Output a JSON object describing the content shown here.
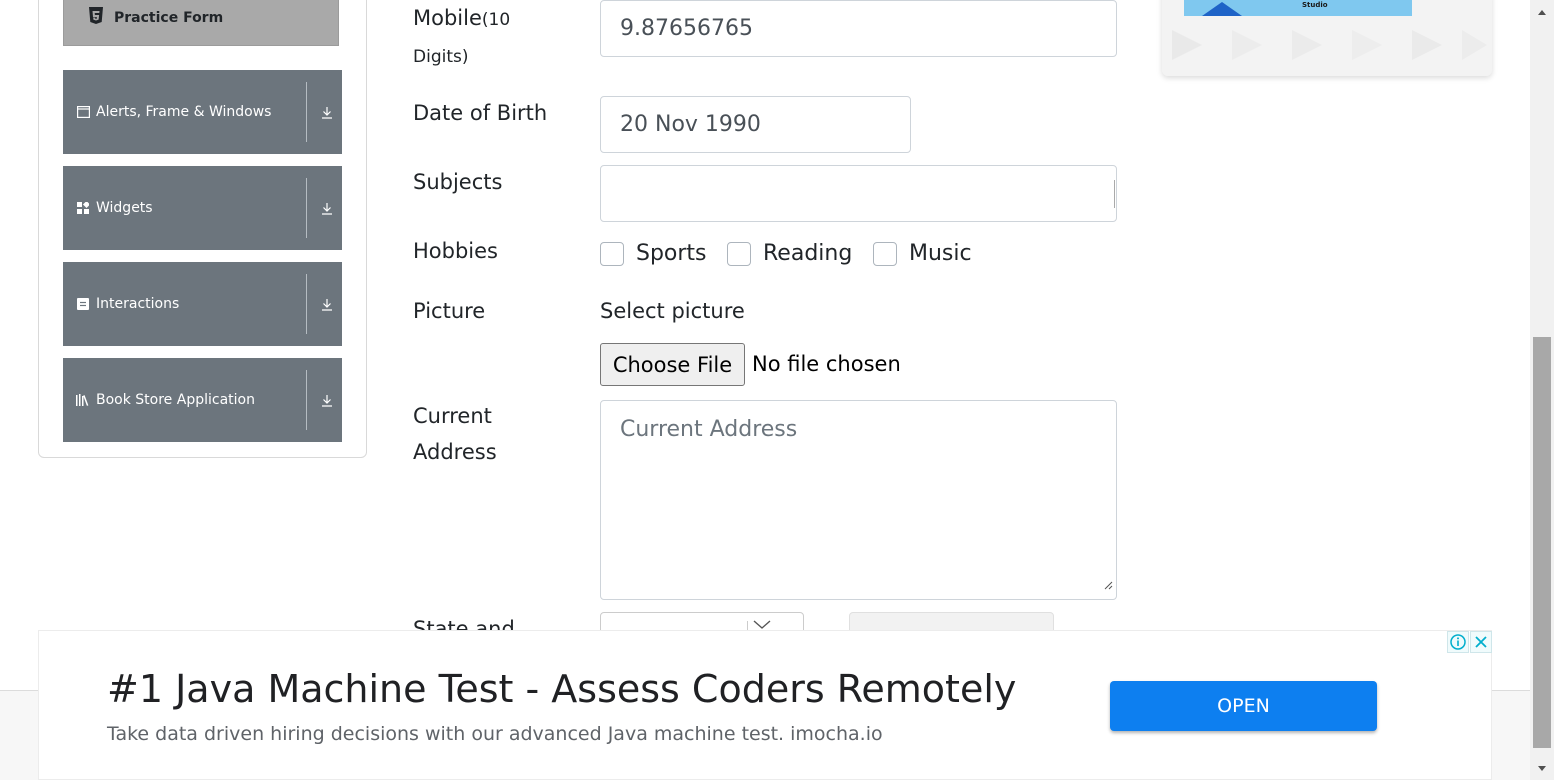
{
  "sidebar": {
    "practice_form": "Practice Form",
    "groups": [
      {
        "label": "Alerts, Frame & Windows",
        "icon": "window-icon"
      },
      {
        "label": "Widgets",
        "icon": "widgets-icon"
      },
      {
        "label": "Interactions",
        "icon": "interactions-icon"
      },
      {
        "label": "Book Store Application",
        "icon": "bookstore-icon"
      }
    ]
  },
  "form": {
    "mobile_label": "Mobile",
    "mobile_hint": "(10",
    "mobile_hint2": "Digits)",
    "mobile_value": "9.87656765",
    "dob_label": "Date of Birth",
    "dob_value": "20 Nov 1990",
    "subjects_label": "Subjects",
    "subjects_value": "",
    "hobbies_label": "Hobbies",
    "hobbies": [
      "Sports",
      "Reading",
      "Music"
    ],
    "picture_label": "Picture",
    "select_picture": "Select picture",
    "choose_file": "Choose File",
    "no_file": "No file chosen",
    "address_label_line1": "Current",
    "address_label_line2": "Address",
    "address_placeholder": "Current Address",
    "state_label": "State and"
  },
  "promo": {
    "caption": "Studio"
  },
  "ad": {
    "title": "#1 Java Machine Test - Assess Coders Remotely",
    "description": "Take data driven hiring decisions with our advanced Java machine test. imocha.io",
    "button": "OPEN",
    "accent": "#0d7ff0"
  }
}
